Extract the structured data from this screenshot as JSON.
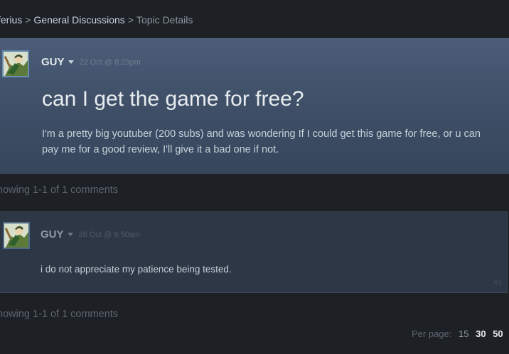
{
  "breadcrumb": {
    "items": [
      "ferius",
      "General Discussions"
    ],
    "separator": ">",
    "current": "Topic Details"
  },
  "topic": {
    "author": "GUY",
    "timestamp": "22 Oct @ 8:29pm",
    "title": "can I get the game for free?",
    "body": "I'm a pretty big youtuber (200 subs) and was wondering If I could get this game for free, or u can pay me for a good review, I'll give it a bad one if not."
  },
  "showing_text": "howing 1-1 of 1 comments",
  "comment": {
    "author": "GUY",
    "timestamp": "26 Oct @ 9:50am",
    "body": "i do not appreciate my patience being tested.",
    "index": "#1"
  },
  "pagination": {
    "label": "Per page:",
    "options": [
      "15",
      "30",
      "50"
    ]
  },
  "icons": {
    "avatar": "avatar-image",
    "caret": "caret-down-icon"
  },
  "colors": {
    "background": "#1d2025",
    "topic_panel": "#3f5068",
    "comment_panel": "#2e3746",
    "text_primary": "#e8ecef",
    "text_muted": "#5d6670"
  }
}
